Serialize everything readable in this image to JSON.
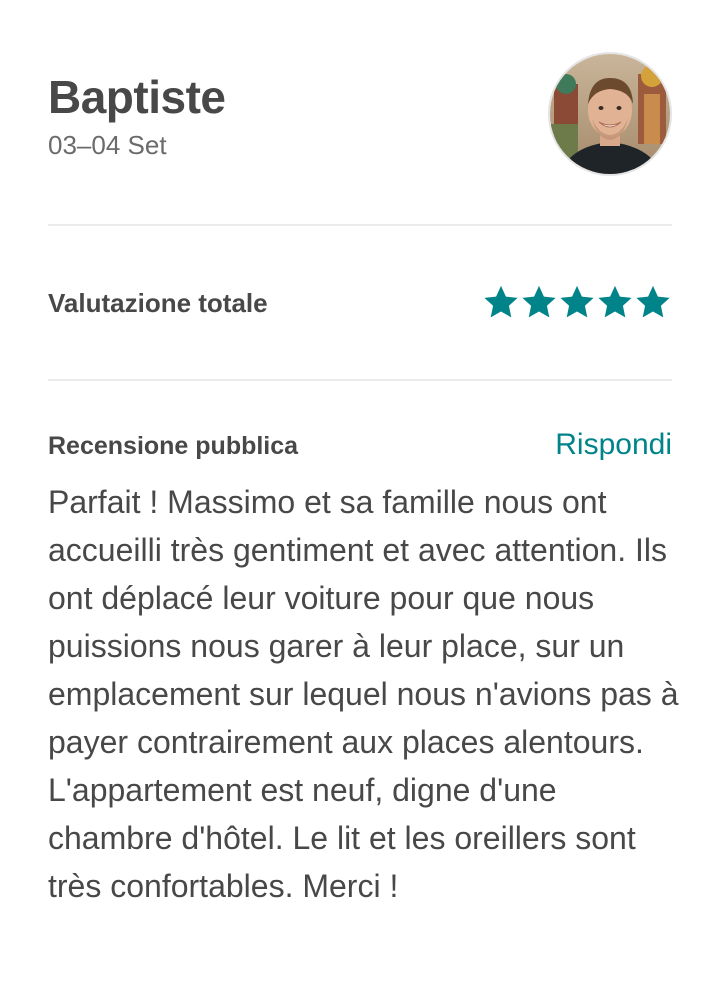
{
  "guest": {
    "name": "Baptiste",
    "dates": "03–04 Set"
  },
  "rating": {
    "label": "Valutazione totale",
    "stars": 5,
    "max_stars": 5,
    "star_color": "#008489"
  },
  "review": {
    "title": "Recensione pubblica",
    "reply_label": "Rispondi",
    "text": "Parfait ! Massimo et sa famille nous ont accueilli très gentiment et avec attention. Ils ont déplacé leur voiture pour que nous puissions nous garer à leur place, sur un emplacement sur lequel nous n'avions pas à payer contrairement aux places alentours. L'appartement est neuf, digne d'une chambre d'hôtel. Le lit et les oreillers sont très confortables. Merci !"
  },
  "colors": {
    "accent": "#008489",
    "text": "#484848",
    "muted": "#6b6b6b",
    "divider": "#ebebeb"
  }
}
